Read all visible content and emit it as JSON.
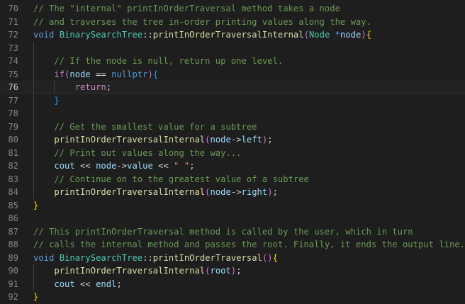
{
  "editor": {
    "current_line": 76,
    "lines": [
      {
        "n": "70",
        "tokens": [
          {
            "t": "// The \"internal\" printInOrderTraversal method takes a node",
            "c": "comment"
          }
        ]
      },
      {
        "n": "71",
        "tokens": [
          {
            "t": "// and traverses the tree in-order printing values along the way.",
            "c": "comment"
          }
        ]
      },
      {
        "n": "72",
        "tokens": [
          {
            "t": "void",
            "c": "keyword"
          },
          {
            "t": " ",
            "c": "plain"
          },
          {
            "t": "BinarySearchTree",
            "c": "type"
          },
          {
            "t": "::",
            "c": "op"
          },
          {
            "t": "printInOrderTraversalInternal",
            "c": "func"
          },
          {
            "t": "(",
            "c": "paren"
          },
          {
            "t": "Node",
            "c": "type"
          },
          {
            "t": " ",
            "c": "plain"
          },
          {
            "t": "*",
            "c": "ptr"
          },
          {
            "t": "node",
            "c": "var"
          },
          {
            "t": ")",
            "c": "paren"
          },
          {
            "t": "{",
            "c": "brace"
          }
        ]
      },
      {
        "n": "73",
        "tokens": []
      },
      {
        "n": "74",
        "tokens": [
          {
            "t": "    // If the node is null, return up one level.",
            "c": "comment"
          }
        ]
      },
      {
        "n": "75",
        "tokens": [
          {
            "t": "    ",
            "c": "plain"
          },
          {
            "t": "if",
            "c": "control"
          },
          {
            "t": "(",
            "c": "paren"
          },
          {
            "t": "node",
            "c": "var"
          },
          {
            "t": " == ",
            "c": "op"
          },
          {
            "t": "nullptr",
            "c": "keyword"
          },
          {
            "t": ")",
            "c": "paren"
          },
          {
            "t": "{",
            "c": "paren2"
          }
        ]
      },
      {
        "n": "76",
        "tokens": [
          {
            "t": "        ",
            "c": "plain"
          },
          {
            "t": "return",
            "c": "control"
          },
          {
            "t": ";",
            "c": "plain"
          }
        ]
      },
      {
        "n": "77",
        "tokens": [
          {
            "t": "    ",
            "c": "plain"
          },
          {
            "t": "}",
            "c": "paren2"
          }
        ]
      },
      {
        "n": "78",
        "tokens": []
      },
      {
        "n": "79",
        "tokens": [
          {
            "t": "    // Get the smallest value for a subtree",
            "c": "comment"
          }
        ]
      },
      {
        "n": "80",
        "tokens": [
          {
            "t": "    ",
            "c": "plain"
          },
          {
            "t": "printInOrderTraversalInternal",
            "c": "func"
          },
          {
            "t": "(",
            "c": "paren"
          },
          {
            "t": "node",
            "c": "var"
          },
          {
            "t": "->",
            "c": "op"
          },
          {
            "t": "left",
            "c": "var"
          },
          {
            "t": ")",
            "c": "paren"
          },
          {
            "t": ";",
            "c": "plain"
          }
        ]
      },
      {
        "n": "81",
        "tokens": [
          {
            "t": "    // Print out values along the way...",
            "c": "comment"
          }
        ]
      },
      {
        "n": "82",
        "tokens": [
          {
            "t": "    ",
            "c": "plain"
          },
          {
            "t": "cout",
            "c": "var"
          },
          {
            "t": " << ",
            "c": "op"
          },
          {
            "t": "node",
            "c": "var"
          },
          {
            "t": "->",
            "c": "op"
          },
          {
            "t": "value",
            "c": "var"
          },
          {
            "t": " << ",
            "c": "op"
          },
          {
            "t": "\" \"",
            "c": "string"
          },
          {
            "t": ";",
            "c": "plain"
          }
        ]
      },
      {
        "n": "83",
        "tokens": [
          {
            "t": "    // Continue on to the greatest value of a subtree",
            "c": "comment"
          }
        ]
      },
      {
        "n": "84",
        "tokens": [
          {
            "t": "    ",
            "c": "plain"
          },
          {
            "t": "printInOrderTraversalInternal",
            "c": "func"
          },
          {
            "t": "(",
            "c": "paren"
          },
          {
            "t": "node",
            "c": "var"
          },
          {
            "t": "->",
            "c": "op"
          },
          {
            "t": "right",
            "c": "var"
          },
          {
            "t": ")",
            "c": "paren"
          },
          {
            "t": ";",
            "c": "plain"
          }
        ]
      },
      {
        "n": "85",
        "tokens": [
          {
            "t": "}",
            "c": "brace"
          }
        ]
      },
      {
        "n": "86",
        "tokens": []
      },
      {
        "n": "87",
        "tokens": [
          {
            "t": "// This printInOrderTraversal method is called by the user, which in turn",
            "c": "comment"
          }
        ]
      },
      {
        "n": "88",
        "tokens": [
          {
            "t": "// calls the internal method and passes the root. Finally, it ends the output line.",
            "c": "comment"
          }
        ]
      },
      {
        "n": "89",
        "tokens": [
          {
            "t": "void",
            "c": "keyword"
          },
          {
            "t": " ",
            "c": "plain"
          },
          {
            "t": "BinarySearchTree",
            "c": "type"
          },
          {
            "t": "::",
            "c": "op"
          },
          {
            "t": "printInOrderTraversal",
            "c": "func"
          },
          {
            "t": "()",
            "c": "paren"
          },
          {
            "t": "{",
            "c": "brace"
          }
        ]
      },
      {
        "n": "90",
        "tokens": [
          {
            "t": "    ",
            "c": "plain"
          },
          {
            "t": "printInOrderTraversalInternal",
            "c": "func"
          },
          {
            "t": "(",
            "c": "paren"
          },
          {
            "t": "root",
            "c": "var"
          },
          {
            "t": ")",
            "c": "paren"
          },
          {
            "t": ";",
            "c": "plain"
          }
        ]
      },
      {
        "n": "91",
        "tokens": [
          {
            "t": "    ",
            "c": "plain"
          },
          {
            "t": "cout",
            "c": "var"
          },
          {
            "t": " << ",
            "c": "op"
          },
          {
            "t": "endl",
            "c": "var"
          },
          {
            "t": ";",
            "c": "plain"
          }
        ]
      },
      {
        "n": "92",
        "tokens": [
          {
            "t": "}",
            "c": "brace"
          }
        ]
      }
    ]
  },
  "colors": {
    "background": "#1e1e1e",
    "comment": "#6a9955",
    "keyword": "#569cd6",
    "control": "#c586c0",
    "type": "#4ec9b0",
    "function": "#dcdcaa",
    "variable": "#9cdcfe",
    "string": "#ce9178",
    "bracket_level1": "#ffd700",
    "bracket_level2": "#da70d6",
    "bracket_level3": "#179fff"
  }
}
